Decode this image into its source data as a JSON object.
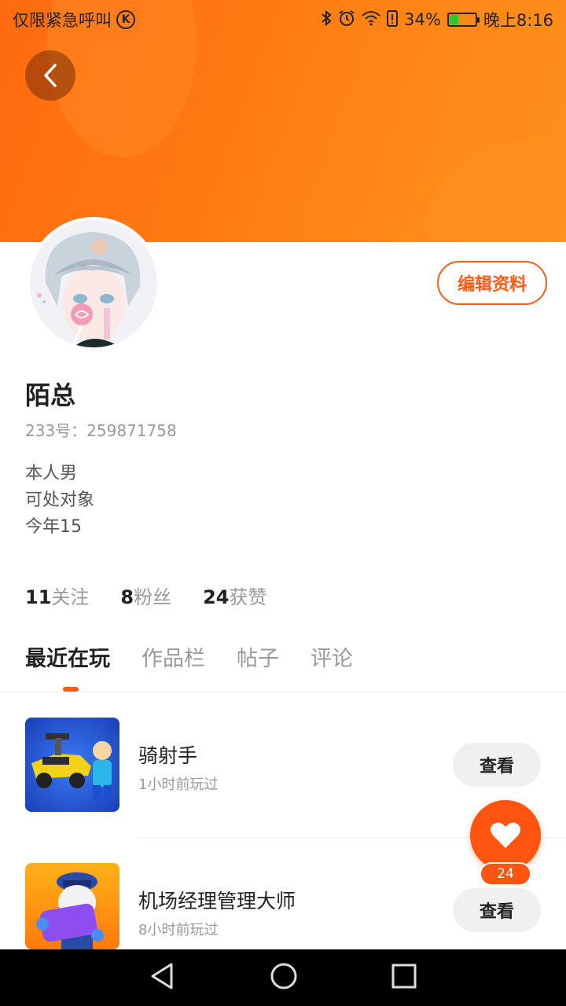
{
  "status_bar": {
    "emergency_text": "仅限紧急呼叫",
    "carrier_badge": "K",
    "battery_percent": "34%",
    "battery_level": 0.34,
    "time": "晚上8:16",
    "icons": [
      "bluetooth-icon",
      "alarm-icon",
      "wifi-icon",
      "battery-alert-icon",
      "battery-charging-icon"
    ]
  },
  "profile": {
    "nickname": "陌总",
    "uid": "233号：259871758",
    "bio": [
      "本人男",
      "可处对象",
      "今年15"
    ],
    "edit_button": "编辑资料"
  },
  "stats": [
    {
      "num": "11",
      "label": "关注"
    },
    {
      "num": "8",
      "label": "粉丝"
    },
    {
      "num": "24",
      "label": "获赞"
    }
  ],
  "tabs": [
    {
      "label": "最近在玩",
      "active": true
    },
    {
      "label": "作品栏",
      "active": false
    },
    {
      "label": "帖子",
      "active": false
    },
    {
      "label": "评论",
      "active": false
    }
  ],
  "games": [
    {
      "name": "骑射手",
      "time": "1小时前玩过",
      "button": "查看"
    },
    {
      "name": "机场经理管理大师",
      "time": "8小时前玩过",
      "button": "查看"
    }
  ],
  "like": {
    "count": "24"
  },
  "colors": {
    "accent": "#ff5b12",
    "header": "#ff7a12"
  }
}
